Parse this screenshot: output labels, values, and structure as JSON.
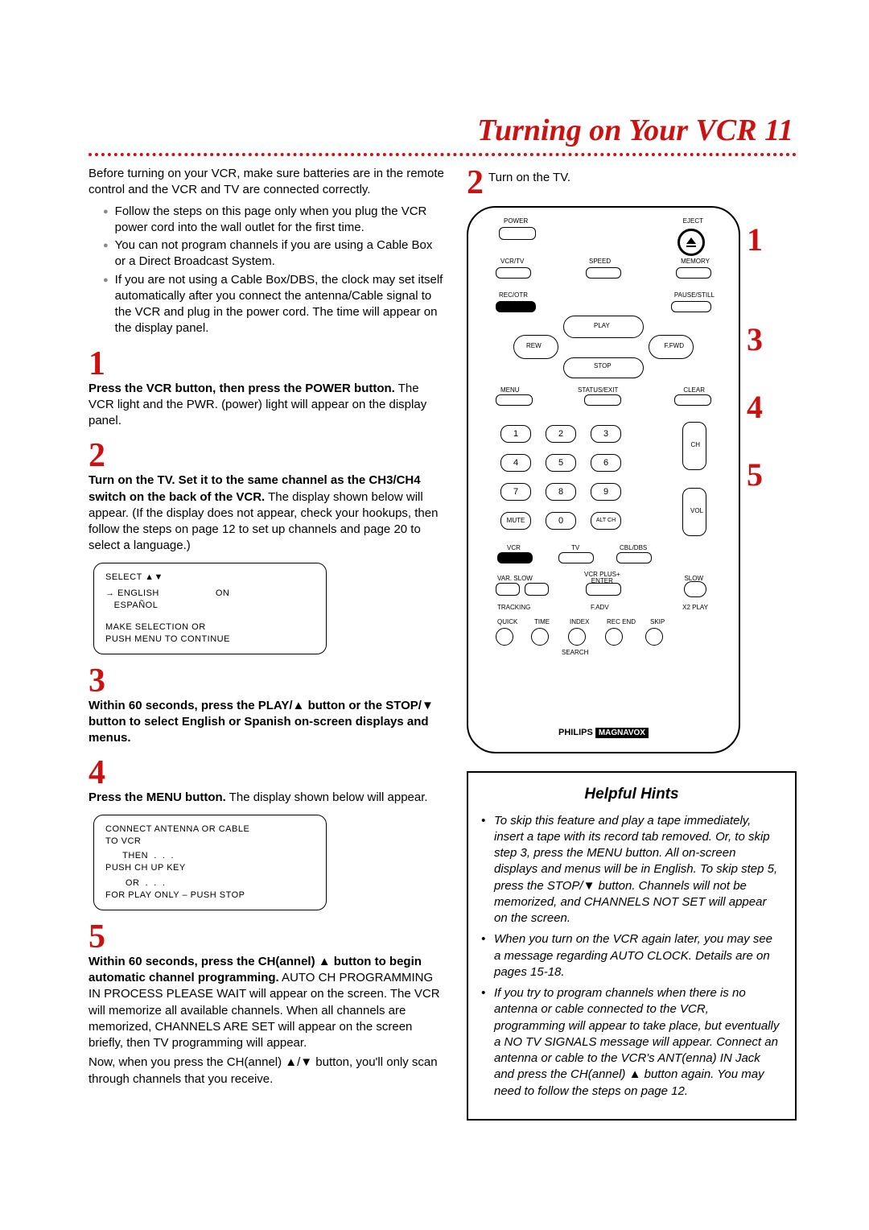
{
  "title": "Turning on Your VCR  11",
  "intro": "Before turning on your VCR, make sure batteries are in the remote control and the VCR and TV are connected correctly.",
  "bullets": [
    "Follow the steps on this page only when you plug the VCR power cord into the wall outlet for the first time.",
    "You can not program channels if you are using a Cable Box or a Direct Broadcast System.",
    "If you are not using a Cable Box/DBS, the clock may set itself automatically after you connect the antenna/Cable signal to the VCR and plug in the power cord. The time will appear on the display panel."
  ],
  "step1": {
    "num": "1",
    "bold": "Press the VCR button, then press the POWER button.",
    "rest": " The VCR light and the PWR. (power) light will appear on the display panel."
  },
  "step2": {
    "num": "2",
    "bold": "Turn on the TV. Set it to the same channel as the CH3/CH4 switch on the back of the VCR.",
    "rest": " The display shown below will appear. (If the display does not appear, check your hookups, then follow the steps on page 12 to set up channels and page 20 to select a language.)"
  },
  "screen1": {
    "l1": "SELECT ▲▼",
    "l2a": "→ ENGLISH",
    "l2b": "ON",
    "l3": "   ESPAÑOL",
    "l4": "MAKE SELECTION OR",
    "l5": "PUSH MENU TO CONTINUE"
  },
  "step3": {
    "num": "3",
    "bold": "Within 60 seconds, press the PLAY/▲ button or the STOP/▼ button to select English or Spanish on-screen displays and menus."
  },
  "step4": {
    "num": "4",
    "bold": "Press the MENU button.",
    "rest": " The display shown below will appear."
  },
  "screen2": {
    "l1": "CONNECT ANTENNA OR CABLE",
    "l2": "TO VCR",
    "l3": "      THEN  .  .  .",
    "l4": "PUSH CH UP KEY",
    "l5": "       OR  .  .  .",
    "l6": "FOR PLAY ONLY – PUSH STOP"
  },
  "step5": {
    "num": "5",
    "bold": "Within 60 seconds, press the CH(annel) ▲ button to begin automatic channel programming.",
    "rest": " AUTO CH PROGRAMMING IN PROCESS PLEASE WAIT will appear on the screen. The VCR will memorize all available channels. When all channels are memorized, CHANNELS ARE SET will appear on the screen briefly, then TV programming will appear.",
    "rest2": "Now, when you press the CH(annel) ▲/▼ button, you'll only scan through channels that you receive."
  },
  "tvon": {
    "num": "2",
    "text": "Turn on the TV."
  },
  "remote_side": [
    "1",
    "3",
    "4",
    "5"
  ],
  "remote": {
    "labels": {
      "power": "POWER",
      "eject": "EJECT",
      "vcrtv": "VCR/TV",
      "speed": "SPEED",
      "memory": "MEMORY",
      "recotr": "REC/OTR",
      "pause": "PAUSE/STILL",
      "play": "PLAY",
      "rew": "REW",
      "ffwd": "F.FWD",
      "stop": "STOP",
      "menu": "MENU",
      "status": "STATUS/EXIT",
      "clear": "CLEAR",
      "ch": "CH",
      "vol": "VOL",
      "mute": "MUTE",
      "altch": "ALT CH",
      "vcr": "VCR",
      "tv": "TV",
      "cbl": "CBL/DBS",
      "varslow": "VAR. SLOW",
      "vcrplus": "VCR PLUS+\nENTER",
      "slow": "SLOW",
      "tracking": "TRACKING",
      "fadv": "F.ADV",
      "x2": "X2 PLAY",
      "quick": "QUICK",
      "time": "TIME",
      "index": "INDEX",
      "recend": "REC END",
      "skip": "SKIP",
      "search": "SEARCH"
    },
    "brand": "PHILIPS",
    "brand2": "MAGNAVOX"
  },
  "hints": {
    "title": "Helpful Hints",
    "items": [
      "To skip this feature and play a tape immediately, insert a tape with its record tab removed. Or, to skip step 3, press the MENU button. All on-screen displays and menus will be in English. To skip step 5, press the STOP/▼ button.  Channels will not be memorized, and CHANNELS NOT SET will appear on the screen.",
      "When you turn on the VCR again later, you may see a message regarding AUTO CLOCK. Details are on pages 15-18.",
      "If you try to program channels when there is no antenna or cable connected to the VCR, programming will appear to take place, but eventually a NO TV SIGNALS message will appear. Connect an antenna or cable to the VCR's ANT(enna) IN Jack and press the CH(annel) ▲ button again. You may need to follow the steps on page 12."
    ]
  }
}
